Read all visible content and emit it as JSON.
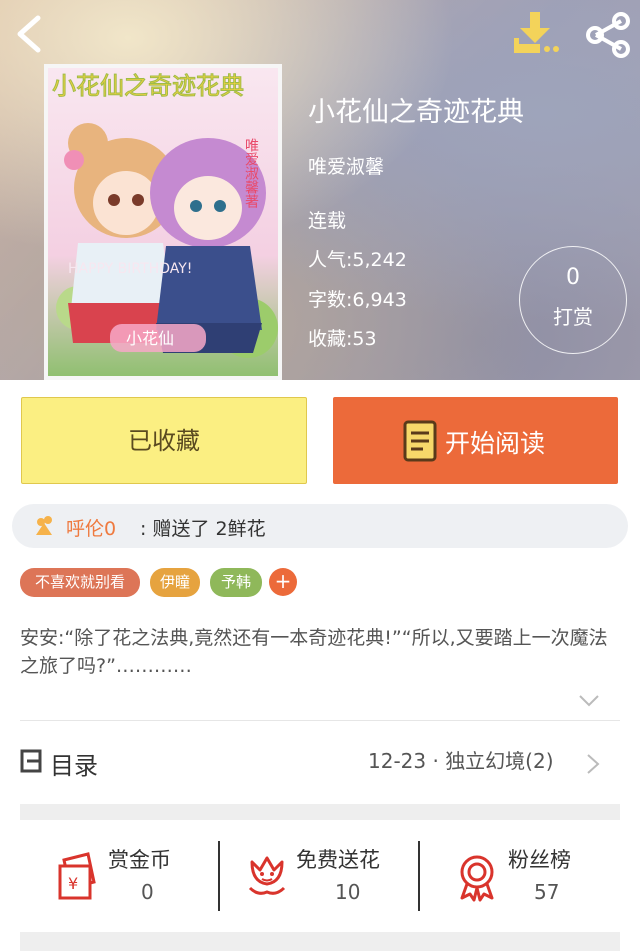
{
  "colors": {
    "accent": "#ec6a3a",
    "favorited": "#fbef82",
    "gift_user": "#ef7a3f"
  },
  "header": {
    "back_icon": "chevron-left-icon",
    "download_icon": "download-icon",
    "share_icon": "share-icon"
  },
  "cover": {
    "title_art": "小花仙之奇迹花典",
    "banner_text": "HAPPY BIRTHDAY!",
    "side_text": "唯爱淑馨著",
    "logo_text": "小花仙"
  },
  "book": {
    "title": "小花仙之奇迹花典",
    "author": "唯爱淑馨",
    "status": "连载",
    "popularity": "人气:5,242",
    "word_count": "字数:6,943",
    "favorites": "收藏:53"
  },
  "reward": {
    "count": "0",
    "label": "打赏"
  },
  "actions": {
    "favorited_label": "已收藏",
    "read_label": "开始阅读"
  },
  "gift": {
    "user": "呼伦0",
    "message": ": 赠送了 2鲜花"
  },
  "tags": [
    "不喜欢就别看",
    "伊瞳",
    "予韩"
  ],
  "tag_add": "+",
  "intro": "安安:“除了花之法典,竟然还有一本奇迹花典!”“所以,又要踏上一次魔法之旅了吗?”…………",
  "toc": {
    "label": "目录",
    "latest": "12-23 · 独立幻境(2)"
  },
  "stats": [
    {
      "icon": "red-envelope-icon",
      "name": "赏金币",
      "value": "0"
    },
    {
      "icon": "flower-icon",
      "name": "免费送花",
      "value": "10"
    },
    {
      "icon": "award-ribbon-icon",
      "name": "粉丝榜",
      "value": "57"
    }
  ]
}
